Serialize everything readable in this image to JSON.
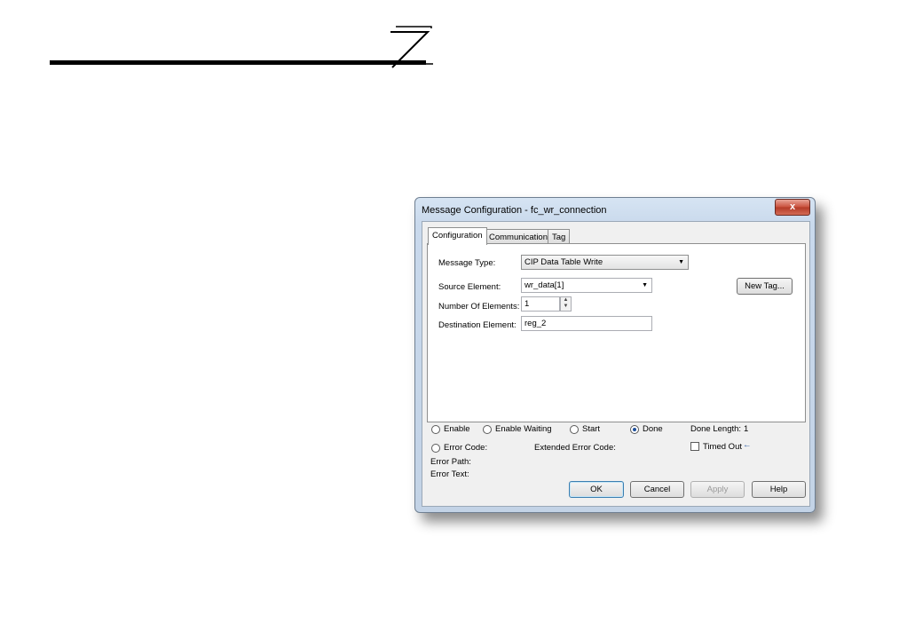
{
  "dialog": {
    "title": "Message Configuration - fc_wr_connection",
    "close_glyph": "x",
    "tabs": [
      "Configuration",
      "Communication",
      "Tag"
    ],
    "message_type_label": "Message Type:",
    "message_type_value": "CIP Data Table Write",
    "source_element_label": "Source Element:",
    "source_element_value": "wr_data[1]",
    "num_elements_label": "Number Of Elements:",
    "num_elements_value": "1",
    "destination_element_label": "Destination Element:",
    "destination_element_value": "reg_2",
    "new_tag_label": "New Tag...",
    "status": {
      "enable": "Enable",
      "enable_waiting": "Enable Waiting",
      "start": "Start",
      "done": "Done",
      "done_length_label": "Done Length:",
      "done_length_value": "1",
      "error_code_label": "Error Code:",
      "extended_error_code_label": "Extended Error Code:",
      "timed_out_label": "Timed Out",
      "timed_out_arrow": "←",
      "error_path_label": "Error Path:",
      "error_text_label": "Error Text:"
    },
    "buttons": {
      "ok": "OK",
      "cancel": "Cancel",
      "apply": "Apply",
      "help": "Help"
    },
    "dropdown_arrow": "▼",
    "spin_up": "▲",
    "spin_down": "▼"
  }
}
